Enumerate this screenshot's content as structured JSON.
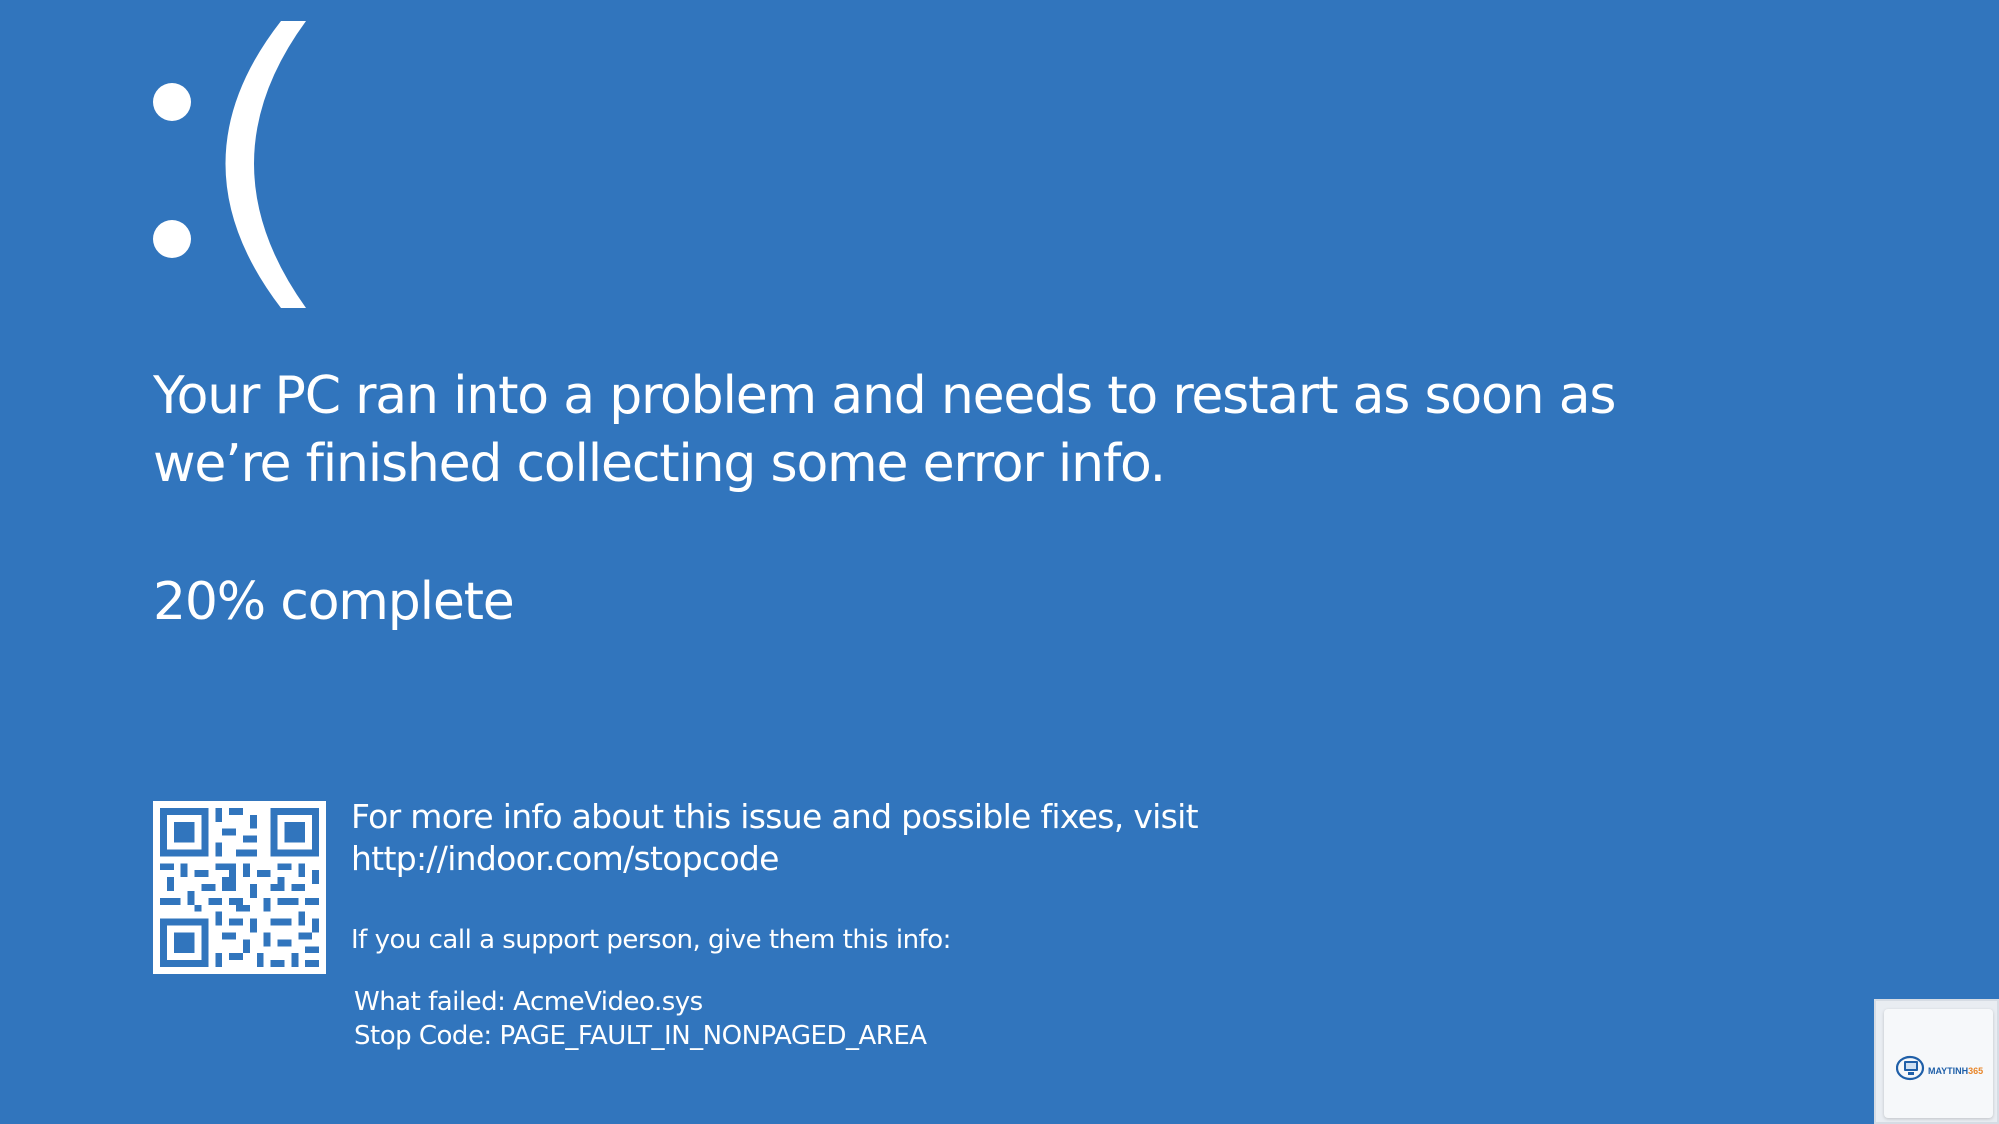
{
  "screen": {
    "background_color": "#3175bd",
    "text_color": "#ffffff"
  },
  "face": {
    "icon": "sad-face-icon",
    "text": ":("
  },
  "message": "Your PC ran into a problem and needs to restart as soon as we’re finished collecting some error info.",
  "progress": {
    "percent": 20,
    "label": "20% complete"
  },
  "qr_code": {
    "icon": "qr-code-icon"
  },
  "more_info": {
    "line1": "For more info about this issue and possible fixes, visit",
    "url": "http://indoor.com/stopcode"
  },
  "support_text": "If you call a support person, give them this info:",
  "details": {
    "what_failed": "What failed: AcmeVideo.sys",
    "stop_code": "Stop Code: PAGE_FAULT_IN_NONPAGED_AREA"
  },
  "watermark": {
    "brand": "MAYTINH365",
    "accent_color": "#e8862a",
    "icon": "computer-logo-icon"
  }
}
